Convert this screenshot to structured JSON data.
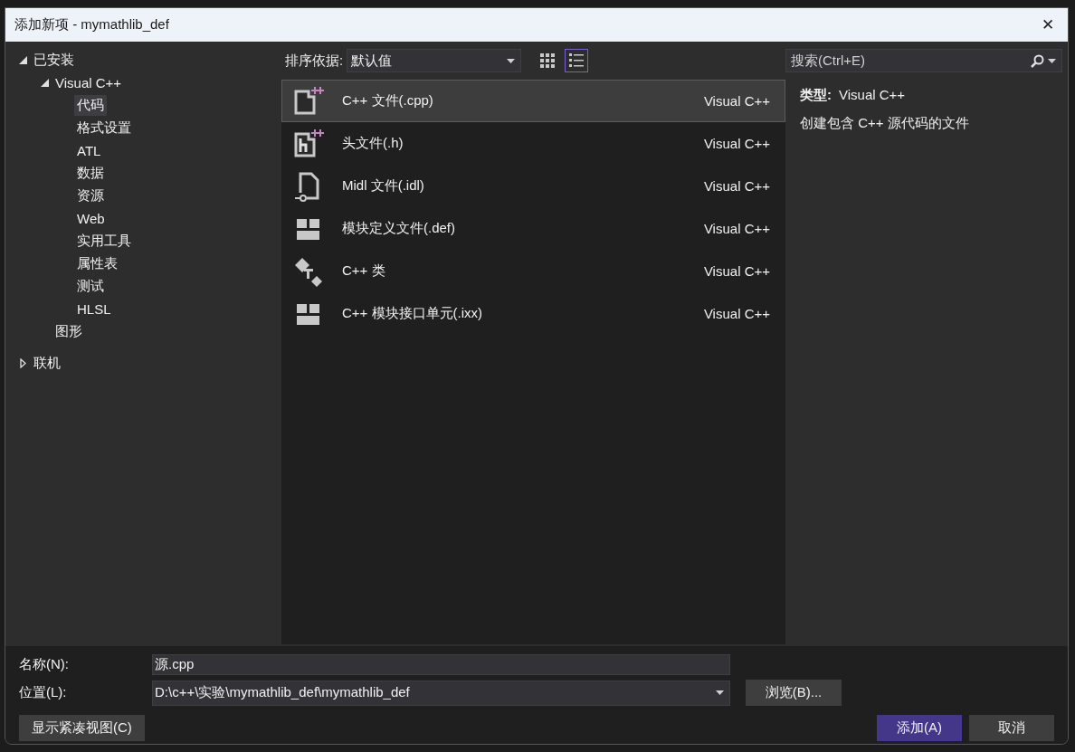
{
  "window": {
    "title": "添加新项 - mymathlib_def",
    "close": "✕"
  },
  "tree": [
    {
      "label": "已安装",
      "expanded": true,
      "selected": false,
      "children": [
        {
          "label": "Visual C++",
          "expanded": true,
          "selected": false,
          "children": [
            {
              "label": "代码",
              "selected": true
            },
            {
              "label": "格式设置",
              "selected": false
            },
            {
              "label": "ATL",
              "selected": false
            },
            {
              "label": "数据",
              "selected": false
            },
            {
              "label": "资源",
              "selected": false
            },
            {
              "label": "Web",
              "selected": false
            },
            {
              "label": "实用工具",
              "selected": false
            },
            {
              "label": "属性表",
              "selected": false
            },
            {
              "label": "测试",
              "selected": false
            },
            {
              "label": "HLSL",
              "selected": false
            }
          ]
        },
        {
          "label": "图形",
          "selected": false
        }
      ]
    },
    {
      "label": "联机",
      "expanded": false,
      "selected": false
    }
  ],
  "sort": {
    "label": "排序依据:",
    "value": "默认值"
  },
  "view_buttons": [
    {
      "kind": "grid",
      "selected": false
    },
    {
      "kind": "list",
      "selected": true
    }
  ],
  "search": {
    "placeholder": "搜索(Ctrl+E)"
  },
  "templates": [
    {
      "kind": "cpp",
      "name": "C++ 文件(.cpp)",
      "type": "Visual C++",
      "selected": true
    },
    {
      "kind": "header",
      "name": "头文件(.h)",
      "type": "Visual C++",
      "selected": false
    },
    {
      "kind": "idl",
      "name": "Midl 文件(.idl)",
      "type": "Visual C++",
      "selected": false
    },
    {
      "kind": "module",
      "name": "模块定义文件(.def)",
      "type": "Visual C++",
      "selected": false
    },
    {
      "kind": "class",
      "name": "C++ 类",
      "type": "Visual C++",
      "selected": false
    },
    {
      "kind": "module",
      "name": "C++ 模块接口单元(.ixx)",
      "type": "Visual C++",
      "selected": false
    }
  ],
  "details": {
    "type_label": "类型:",
    "type_value": "Visual C++",
    "description": "创建包含 C++ 源代码的文件"
  },
  "name_field": {
    "label": "名称(N):",
    "value": "源.cpp"
  },
  "location_field": {
    "label": "位置(L):",
    "value": "D:\\c++\\实验\\mymathlib_def\\mymathlib_def"
  },
  "buttons": {
    "browse": "浏览(B)...",
    "compact": "显示紧凑视图(C)",
    "add": "添加(A)",
    "cancel": "取消"
  }
}
